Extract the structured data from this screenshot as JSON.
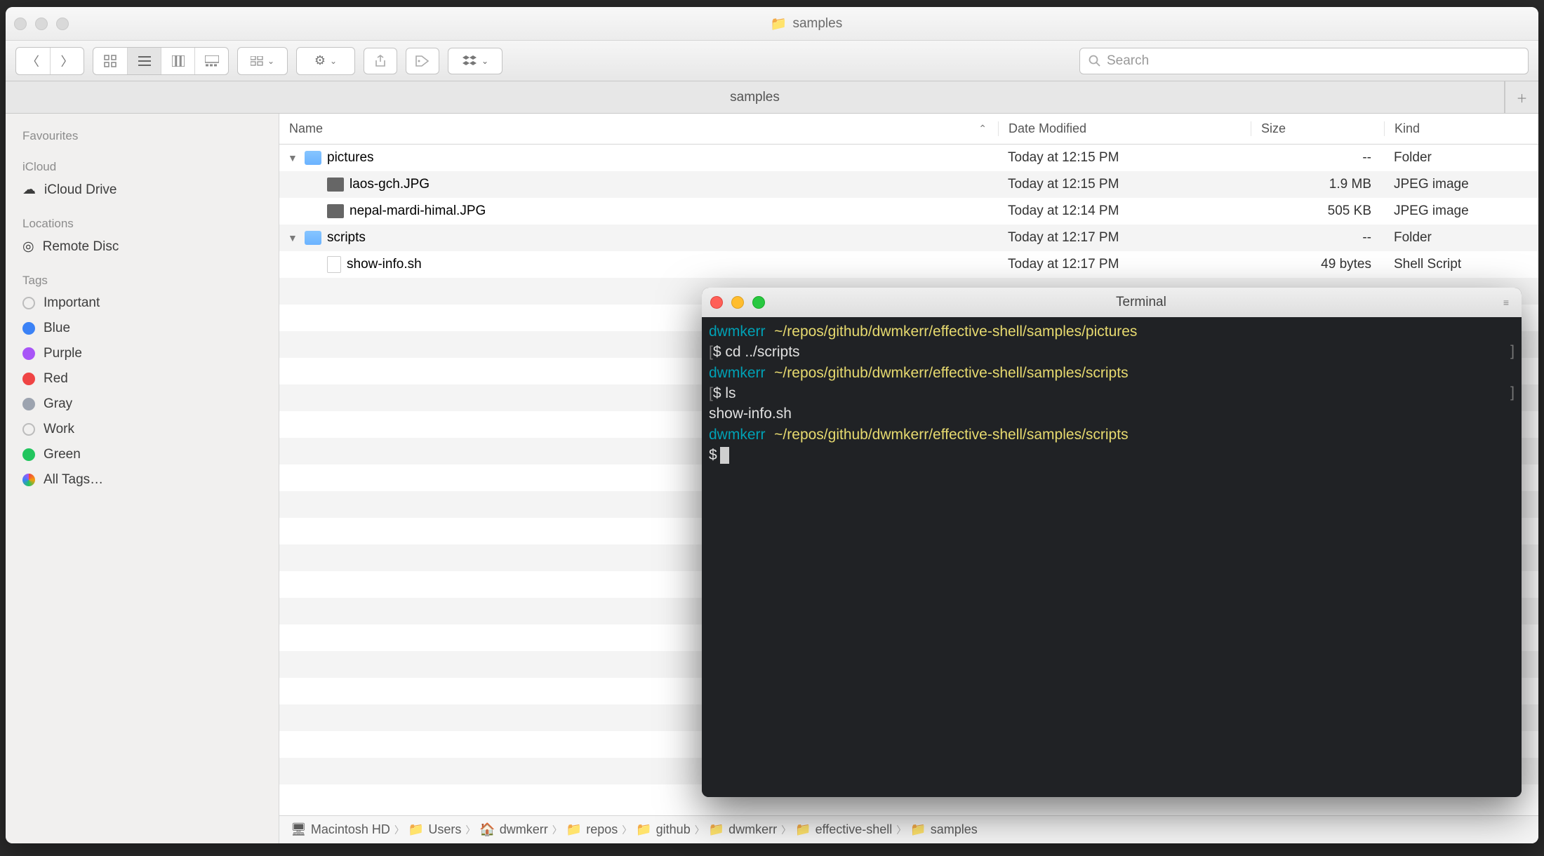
{
  "finder": {
    "window_title": "samples",
    "tab_label": "samples",
    "search_placeholder": "Search",
    "columns": {
      "name": "Name",
      "date": "Date Modified",
      "size": "Size",
      "kind": "Kind"
    },
    "rows": [
      {
        "name": "pictures",
        "date": "Today at 12:15 PM",
        "size": "--",
        "kind": "Folder",
        "type": "folder",
        "indent": 0
      },
      {
        "name": "laos-gch.JPG",
        "date": "Today at 12:15 PM",
        "size": "1.9 MB",
        "kind": "JPEG image",
        "type": "image",
        "indent": 1
      },
      {
        "name": "nepal-mardi-himal.JPG",
        "date": "Today at 12:14 PM",
        "size": "505 KB",
        "kind": "JPEG image",
        "type": "image",
        "indent": 1
      },
      {
        "name": "scripts",
        "date": "Today at 12:17 PM",
        "size": "--",
        "kind": "Folder",
        "type": "folder",
        "indent": 0
      },
      {
        "name": "show-info.sh",
        "date": "Today at 12:17 PM",
        "size": "49 bytes",
        "kind": "Shell Script",
        "type": "file",
        "indent": 1
      }
    ],
    "path": [
      "Macintosh HD",
      "Users",
      "dwmkerr",
      "repos",
      "github",
      "dwmkerr",
      "effective-shell",
      "samples"
    ]
  },
  "sidebar": {
    "sections": {
      "favourites": "Favourites",
      "icloud": "iCloud",
      "icloud_drive": "iCloud Drive",
      "locations": "Locations",
      "remote_disc": "Remote Disc",
      "tags": "Tags"
    },
    "tags": [
      "Important",
      "Blue",
      "Purple",
      "Red",
      "Gray",
      "Work",
      "Green",
      "All Tags…"
    ]
  },
  "terminal": {
    "title": "Terminal",
    "user": "dwmkerr",
    "path1": "~/repos/github/dwmkerr/effective-shell/samples/pictures",
    "cmd1": "cd ../scripts",
    "path2": "~/repos/github/dwmkerr/effective-shell/samples/scripts",
    "cmd2": "ls",
    "output2": "show-info.sh",
    "path3": "~/repos/github/dwmkerr/effective-shell/samples/scripts",
    "prompt": "$"
  }
}
